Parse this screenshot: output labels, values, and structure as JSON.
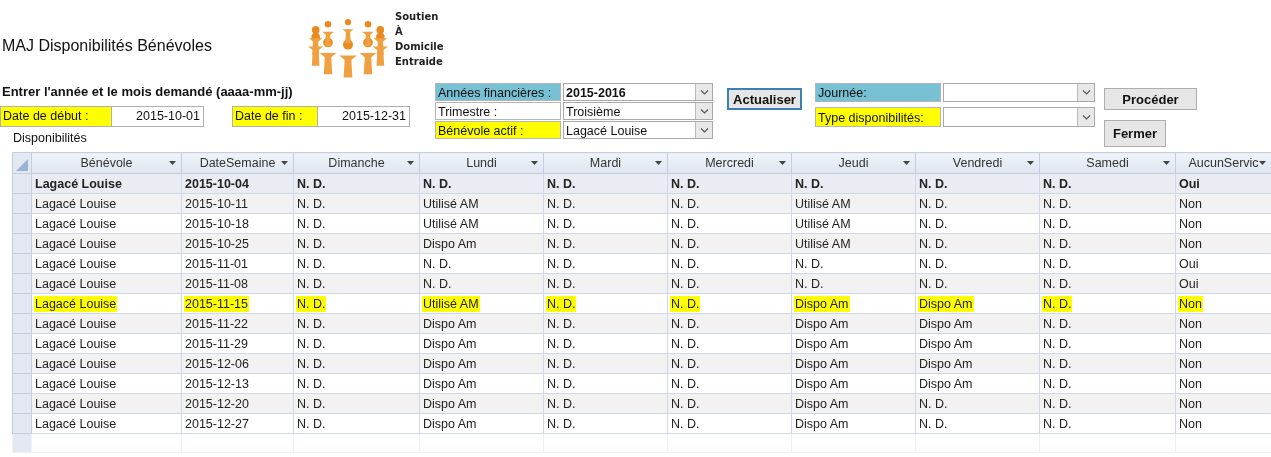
{
  "title": "MAJ Disponibilités Bénévoles",
  "logo": {
    "lines": [
      "Soutien",
      "À",
      "Domicile",
      "Entraide"
    ]
  },
  "instruction": "Entrer l'année et le mois demandé (aaaa-mm-jj)",
  "date_fields": [
    {
      "label": "Date de début :",
      "value": "2015-10-01",
      "color": "#ffff00"
    },
    {
      "label": "Date de fin :",
      "value": "2015-12-31",
      "color": "#ffff00"
    }
  ],
  "subform_label": "Disponibilités",
  "filters": [
    {
      "label": "Années financières :",
      "value": "2015-2016",
      "color": "#78c1d4",
      "bold": true
    },
    {
      "label": "Trimestre :",
      "value": "Troisième",
      "color": "#ffffff",
      "bold": false
    },
    {
      "label": "Bénévole actif :",
      "value": "Lagacé Louise",
      "color": "#ffff00",
      "bold": false
    }
  ],
  "refresh_button": "Actualiser",
  "day_filters": [
    {
      "label": "Journée:",
      "color": "#78c1d4"
    },
    {
      "label": "Type disponibilités:",
      "color": "#ffff00"
    }
  ],
  "buttons": [
    "Procéder",
    "Fermer"
  ],
  "table": {
    "columns": [
      "Bénévole",
      "DateSemaine",
      "Dimanche",
      "Lundi",
      "Mardi",
      "Mercredi",
      "Jeudi",
      "Vendredi",
      "Samedi",
      "AucunServic"
    ],
    "rows": [
      {
        "cells": [
          "Lagacé Louise",
          "2015-10-04",
          "N. D.",
          "N. D.",
          "N. D.",
          "N. D.",
          "N. D.",
          "N. D.",
          "N. D.",
          "Oui"
        ],
        "current": true,
        "highlighted": false
      },
      {
        "cells": [
          "Lagacé Louise",
          "2015-10-11",
          "N. D.",
          "Utilisé AM",
          "N. D.",
          "N. D.",
          "Utilisé AM",
          "N. D.",
          "N. D.",
          "Non"
        ],
        "current": false,
        "highlighted": false
      },
      {
        "cells": [
          "Lagacé Louise",
          "2015-10-18",
          "N. D.",
          "Utilisé AM",
          "N. D.",
          "N. D.",
          "Utilisé AM",
          "N. D.",
          "N. D.",
          "Non"
        ],
        "current": false,
        "highlighted": false
      },
      {
        "cells": [
          "Lagacé Louise",
          "2015-10-25",
          "N. D.",
          "Dispo Am",
          "N. D.",
          "N. D.",
          "Utilisé AM",
          "N. D.",
          "N. D.",
          "Non"
        ],
        "current": false,
        "highlighted": false
      },
      {
        "cells": [
          "Lagacé Louise",
          "2015-11-01",
          "N. D.",
          "N. D.",
          "N. D.",
          "N. D.",
          "N. D.",
          "N. D.",
          "N. D.",
          "Oui"
        ],
        "current": false,
        "highlighted": false
      },
      {
        "cells": [
          "Lagacé Louise",
          "2015-11-08",
          "N. D.",
          "N. D.",
          "N. D.",
          "N. D.",
          "N. D.",
          "N. D.",
          "N. D.",
          "Oui"
        ],
        "current": false,
        "highlighted": false
      },
      {
        "cells": [
          "Lagacé Louise",
          "2015-11-15",
          "N. D.",
          "Utilisé AM",
          "N. D.",
          "N. D.",
          "Dispo Am",
          "Dispo Am",
          "N. D.",
          "Non"
        ],
        "current": false,
        "highlighted": true
      },
      {
        "cells": [
          "Lagacé Louise",
          "2015-11-22",
          "N. D.",
          "Dispo Am",
          "N. D.",
          "N. D.",
          "Dispo Am",
          "Dispo Am",
          "N. D.",
          "Non"
        ],
        "current": false,
        "highlighted": false
      },
      {
        "cells": [
          "Lagacé Louise",
          "2015-11-29",
          "N. D.",
          "Dispo Am",
          "N. D.",
          "N. D.",
          "Dispo Am",
          "Dispo Am",
          "N. D.",
          "Non"
        ],
        "current": false,
        "highlighted": false
      },
      {
        "cells": [
          "Lagacé Louise",
          "2015-12-06",
          "N. D.",
          "Dispo Am",
          "N. D.",
          "N. D.",
          "Dispo Am",
          "Dispo Am",
          "N. D.",
          "Non"
        ],
        "current": false,
        "highlighted": false
      },
      {
        "cells": [
          "Lagacé Louise",
          "2015-12-13",
          "N. D.",
          "Dispo Am",
          "N. D.",
          "N. D.",
          "Dispo Am",
          "Dispo Am",
          "N. D.",
          "Non"
        ],
        "current": false,
        "highlighted": false
      },
      {
        "cells": [
          "Lagacé Louise",
          "2015-12-20",
          "N. D.",
          "Dispo Am",
          "N. D.",
          "N. D.",
          "Dispo Am",
          "N. D.",
          "N. D.",
          "Non"
        ],
        "current": false,
        "highlighted": false
      },
      {
        "cells": [
          "Lagacé Louise",
          "2015-12-27",
          "N. D.",
          "Dispo Am",
          "N. D.",
          "N. D.",
          "Dispo Am",
          "N. D.",
          "N. D.",
          "Non"
        ],
        "current": false,
        "highlighted": false
      }
    ]
  }
}
